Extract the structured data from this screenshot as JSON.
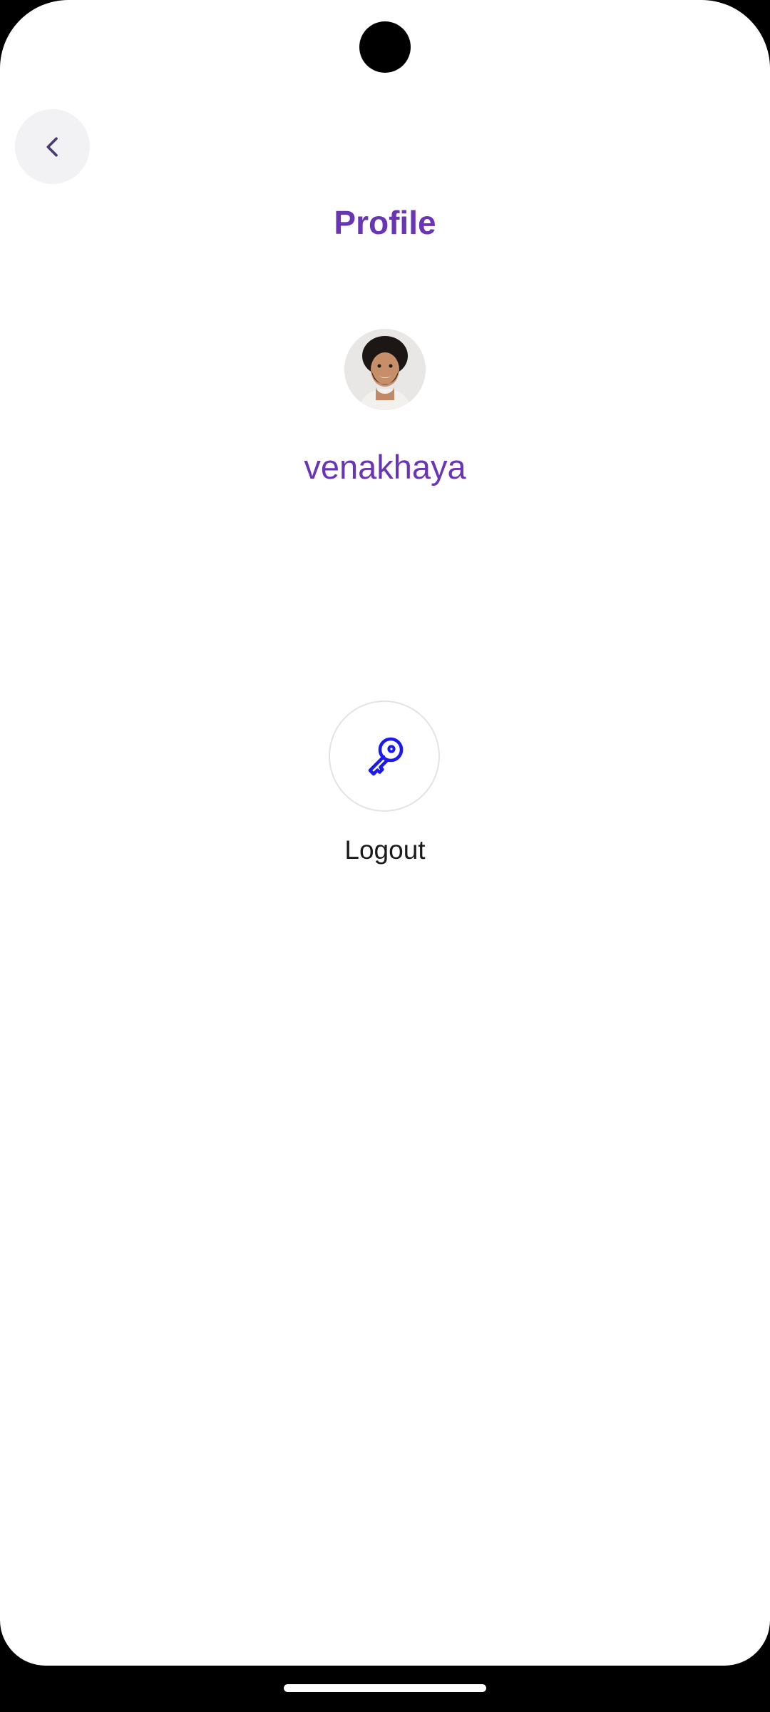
{
  "header": {
    "back_icon": "chevron-left-icon",
    "title": "Profile"
  },
  "profile": {
    "avatar_icon": "user-avatar-photo",
    "username": "venakhaya"
  },
  "actions": {
    "logout_icon": "key-icon",
    "logout_label": "Logout"
  },
  "colors": {
    "accent": "#6a35b4",
    "icon_blue": "#1a1aef",
    "back_icon": "#4a3a72",
    "back_button_bg": "#f2f1f3",
    "text": "#1a1a1a",
    "background": "#ffffff"
  }
}
